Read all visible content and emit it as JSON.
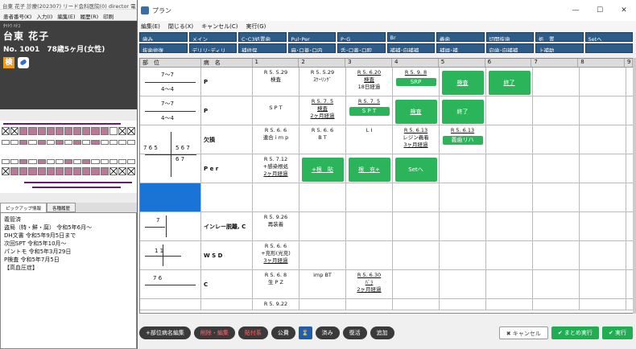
{
  "bg": {
    "title": "台東 花子 診療(202307) リード会科医院(0) director 電",
    "menu": [
      "患者番号(K)",
      "入力(I)",
      "編集(E)",
      "履歴(R)",
      "印刷"
    ]
  },
  "patient": {
    "kana": "ﾀｲﾄｳ ﾊﾅｺ",
    "name": "台東 花子",
    "info": "No. 1001　78歳5ヶ月(女性)",
    "badge": "検"
  },
  "pickup": {
    "tabs": [
      "ピックアップ情報",
      "各種履歴"
    ],
    "lines": [
      "義管済",
      "盗局（特・鮮・腐） 令和5年6月～",
      "DH文書 令和5年9月5日まで",
      "次回SPT 令和5年10月～",
      "パントモ 令和5年3月29日",
      "P検査 令和5年7月5日",
      "【高血圧症】"
    ]
  },
  "app": {
    "title": "プラン",
    "menu": [
      "編集(E)",
      "閉じる(X)",
      "キャンセル(C)",
      "実行(G)"
    ],
    "window_buttons": [
      "—",
      "☐",
      "✕"
    ],
    "toolbar": [
      "歯み",
      "メイン",
      "C･C3処置歯",
      "Pul･Per",
      "P･G",
      "Br",
      "義歯",
      "切開抜歯",
      "処　置",
      "Setへ",
      "抜歯修復",
      "デリリ･ディリ",
      "補修保",
      "麻･口蓋･口内",
      "舌･口蓋･口腔",
      "補補･向補補",
      "補綴･補",
      "向歯･向補補",
      "上補助",
      ""
    ],
    "columns": [
      "部　位",
      "病　名",
      "1",
      "2",
      "3",
      "4",
      "5",
      "6",
      "7",
      "8",
      "9"
    ]
  },
  "rows": [
    {
      "t1": "7～7",
      "t2": "4～4",
      "name": "P",
      "c1": [
        "R 5. 5.29",
        "検査"
      ],
      "c2": [
        "R 5. 5.29",
        "ｽｹｰﾘﾝｸﾞ"
      ],
      "c3": [
        "R 5. 6.20",
        "検査",
        "18日経過"
      ],
      "c4": [
        "R 5. 9. 8",
        "SRP"
      ],
      "b5": "検査",
      "b6": "終了"
    },
    {
      "t1": "7～7",
      "t2": "4～4",
      "name": "P",
      "c1": [
        "S P T"
      ],
      "c2": [
        "R 5. 7. 5",
        "検査",
        "2ヶ月経過"
      ],
      "c3": [
        "R 5. 7. 5",
        "S P T"
      ],
      "b4": "検査",
      "b5": "終了"
    },
    {
      "tl": "7 6 5",
      "tr": "5 6 7",
      "tb": "6 7",
      "name": "欠損",
      "c1": [
        "R 5. 6. 6",
        "連合 i m p"
      ],
      "c2": [
        "R 5. 6. 6",
        "B T"
      ],
      "c3": [
        "",
        "L I"
      ],
      "c4": [
        "R 5. 6.13",
        "レジン義着",
        "3ヶ月経過"
      ],
      "c5": [
        "R 5. 6.13",
        "義歯リハ"
      ]
    },
    {
      "name": "P e r",
      "c1": [
        "R 5. 7.12",
        "+感染根処",
        "2ヶ月経過"
      ],
      "b2": "+根　貼",
      "b3": "根　充+",
      "b4": "Setへ"
    },
    {
      "t1": "7",
      "name": "インレー脱離, C",
      "c1": [
        "R 5. 9.26",
        "再装着"
      ]
    },
    {
      "t1": "1 1",
      "name": "W S D",
      "c1": [
        "R 5. 6. 6",
        "+充形(光充)",
        "3ヶ月経過"
      ]
    },
    {
      "t1": "7 6",
      "name": "C",
      "c1": [
        "R 5. 6. 8",
        "生 P Z"
      ],
      "c2": [
        "",
        "imp BT"
      ],
      "c3": [
        "R 5. 6.30",
        "ﾊﾞﾗ",
        "2ヶ月経過"
      ]
    },
    {
      "name": "",
      "c1": [
        "R 5. 9.22"
      ]
    }
  ],
  "bottom": [
    "+部位病名編集",
    "削除・編集",
    "貼付系",
    "公費",
    "⌛",
    "済み",
    "復活",
    "追加",
    "✖ キャンセル",
    "✔ まとめ実行",
    "✔ 実行"
  ]
}
